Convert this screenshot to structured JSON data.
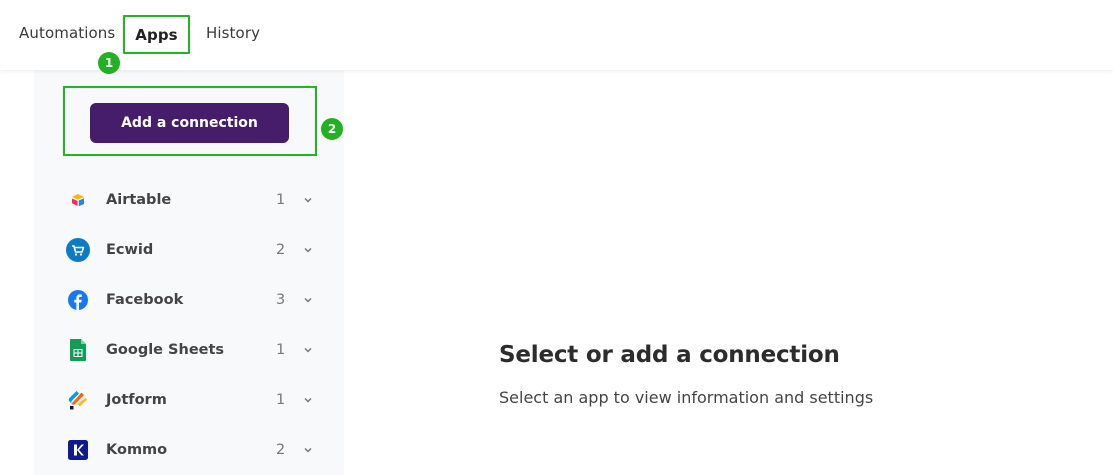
{
  "nav": {
    "tabs": [
      {
        "label": "Automations"
      },
      {
        "label": "Apps"
      },
      {
        "label": "History"
      }
    ]
  },
  "markers": [
    "1",
    "2"
  ],
  "sidebar": {
    "add_button_label": "Add a connection",
    "apps": [
      {
        "name": "Airtable",
        "count": "1",
        "icon": "airtable-icon"
      },
      {
        "name": "Ecwid",
        "count": "2",
        "icon": "ecwid-icon"
      },
      {
        "name": "Facebook",
        "count": "3",
        "icon": "facebook-icon"
      },
      {
        "name": "Google Sheets",
        "count": "1",
        "icon": "google-sheets-icon"
      },
      {
        "name": "Jotform",
        "count": "1",
        "icon": "jotform-icon"
      },
      {
        "name": "Kommo",
        "count": "2",
        "icon": "kommo-icon"
      }
    ]
  },
  "main": {
    "title": "Select or add a connection",
    "subtitle": "Select an app to view information and settings"
  },
  "colors": {
    "accent_button": "#461d6a",
    "highlight": "#21b521",
    "sidebar_bg": "#f7f9fb"
  }
}
